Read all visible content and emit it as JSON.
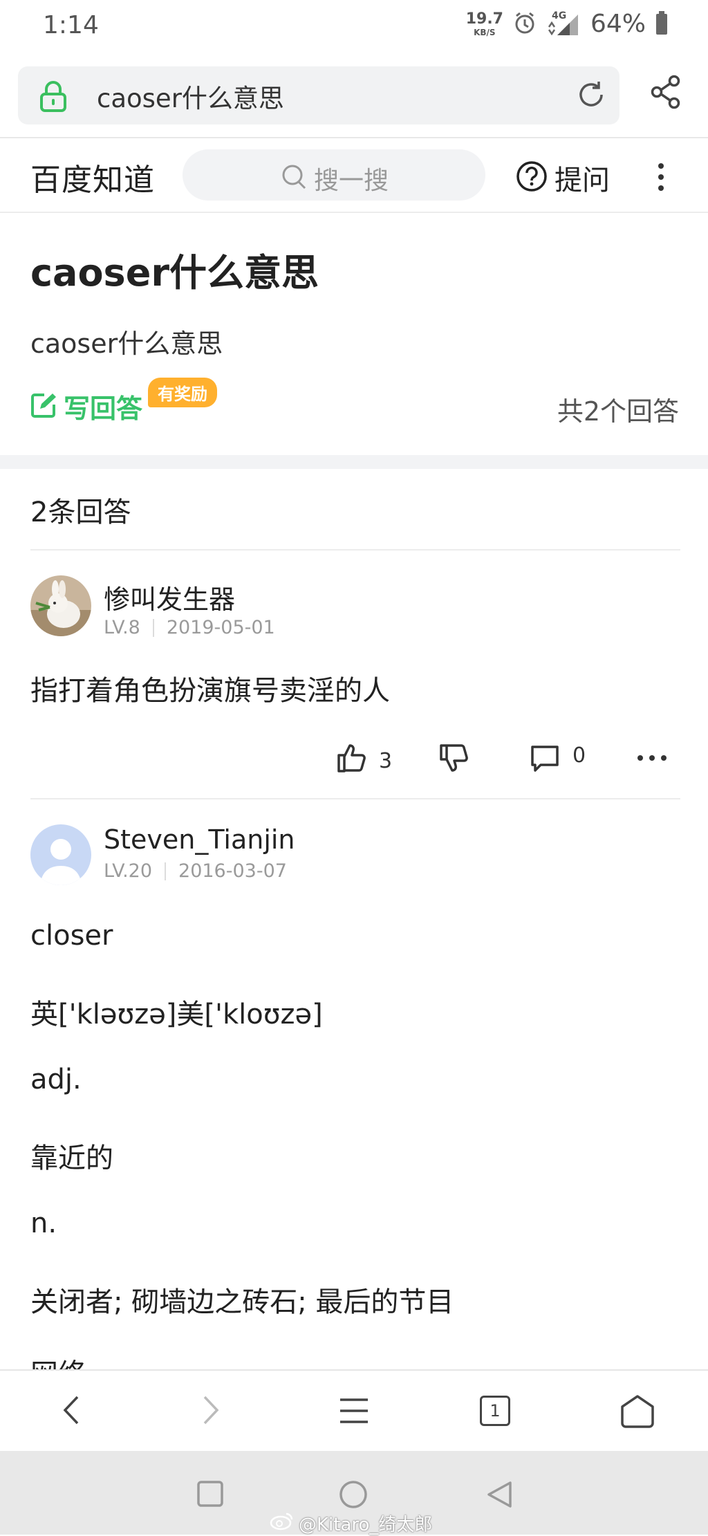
{
  "status_bar": {
    "time": "1:14",
    "net_speed_value": "19.7",
    "net_speed_unit": "KB/S",
    "network_type": "4G",
    "battery_percent": "64%"
  },
  "browser": {
    "url_text": "caoser什么意思"
  },
  "site_header": {
    "brand": "百度知道",
    "search_placeholder": "搜一搜",
    "ask_label": "提问"
  },
  "question": {
    "title": "caoser什么意思",
    "description": "caoser什么意思",
    "write_answer_label": "写回答",
    "reward_badge": "有奖励",
    "total_answers": "共2个回答"
  },
  "answers_header": "2条回答",
  "answers": [
    {
      "username": "惨叫发生器",
      "level": "LV.8",
      "date": "2019-05-01",
      "text": "指打着角色扮演旗号卖淫的人",
      "likes": "3",
      "comments": "0"
    },
    {
      "username": "Steven_Tianjin",
      "level": "LV.20",
      "date": "2016-03-07",
      "paragraphs": [
        "closer",
        "英['kləʊzə]美['kloʊzə]",
        "adj.",
        "靠近的",
        "n.",
        "关闭者; 砌墙边之砖石; 最后的节目",
        "网络"
      ]
    }
  ],
  "toolbar": {
    "tab_count": "1"
  },
  "watermark": "@Kitaro_绮太郎",
  "colors": {
    "accent_green": "#38c26a",
    "reward_orange": "#ffb02e"
  }
}
